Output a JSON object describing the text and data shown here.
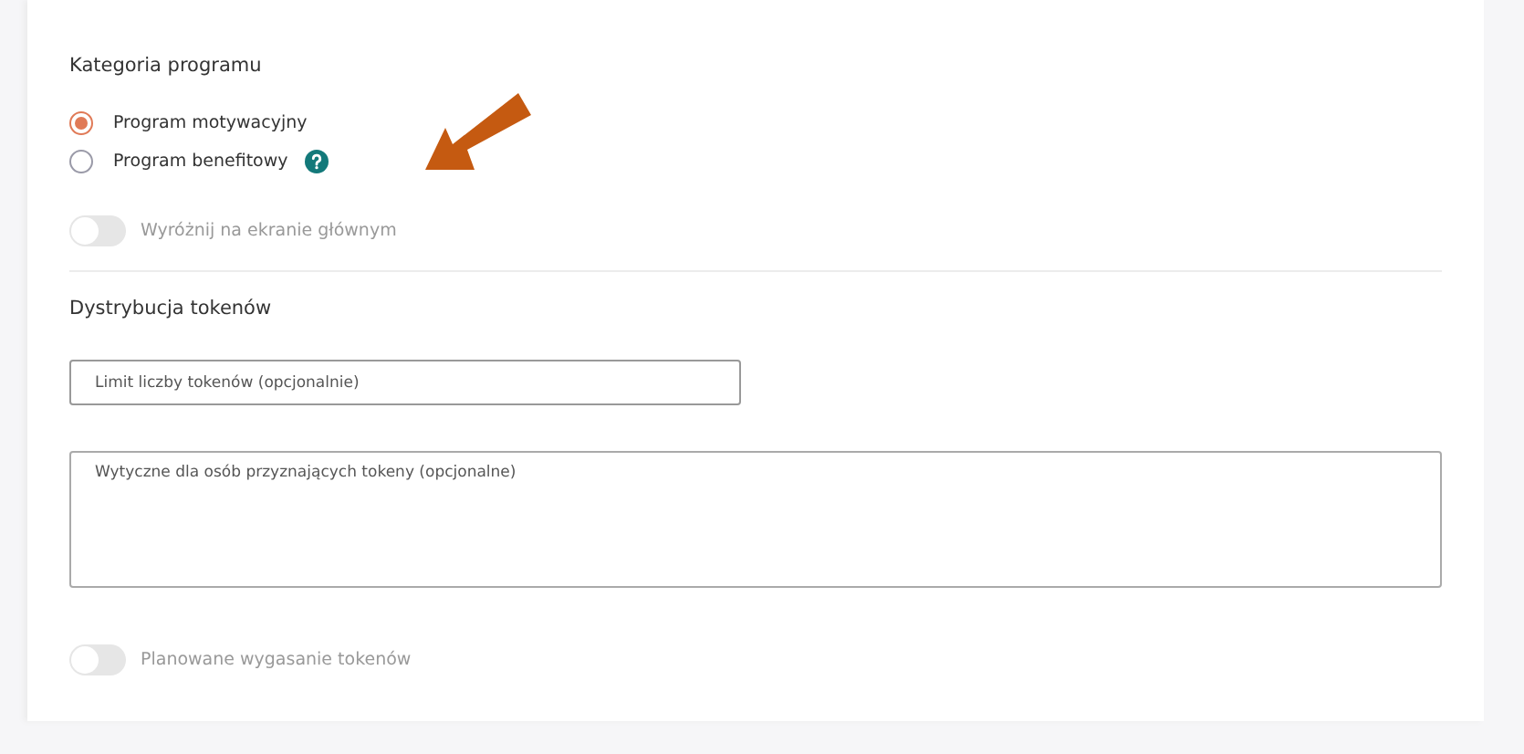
{
  "category": {
    "title": "Kategoria programu",
    "options": [
      {
        "label": "Program motywacyjny",
        "selected": true,
        "help": false
      },
      {
        "label": "Program benefitowy",
        "selected": false,
        "help": true
      }
    ]
  },
  "highlight_toggle": {
    "label": "Wyróżnij na ekranie głównym",
    "on": false
  },
  "distribution": {
    "title": "Dystrybucja tokenów",
    "limit_field": {
      "placeholder": "Limit liczby tokenów (opcjonalnie)"
    },
    "guidelines_field": {
      "placeholder": "Wytyczne dla osób przyznających tokeny (opcjonalne)"
    }
  },
  "expiry_toggle": {
    "label": "Planowane wygasanie tokenów",
    "on": false
  }
}
